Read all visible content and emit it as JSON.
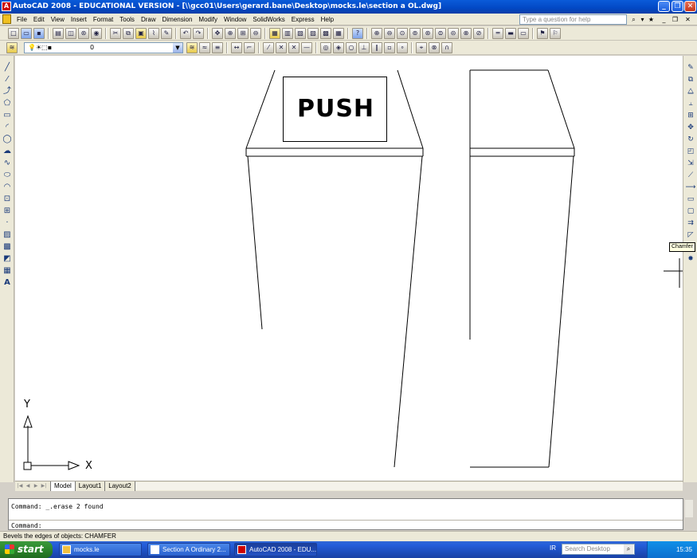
{
  "window": {
    "title": "AutoCAD 2008 - EDUCATIONAL VERSION - [\\\\gcc01\\Users\\gerard.bane\\Desktop\\mocks.le\\section a OL.dwg]",
    "help_placeholder": "Type a question for help"
  },
  "menu": [
    "File",
    "Edit",
    "View",
    "Insert",
    "Format",
    "Tools",
    "Draw",
    "Dimension",
    "Modify",
    "Window",
    "SolidWorks",
    "Express",
    "Help"
  ],
  "layer": {
    "current": "0"
  },
  "drawing": {
    "sign_text": "PUSH"
  },
  "ucs": {
    "x_label": "X",
    "y_label": "Y"
  },
  "tooltip": "Chamfer",
  "layout_tabs": [
    "Model",
    "Layout1",
    "Layout2"
  ],
  "command": {
    "history": "Command:  _.erase 2 found",
    "prompt": "Command:"
  },
  "status_text": "Bevels the edges of objects:  CHAMFER",
  "taskbar": {
    "start": "start",
    "tasks": [
      "mocks.le",
      "Section A Ordinary 2...",
      "AutoCAD 2008 - EDU..."
    ],
    "lang": "IR",
    "search_placeholder": "Search Desktop",
    "clock": "15:35"
  }
}
